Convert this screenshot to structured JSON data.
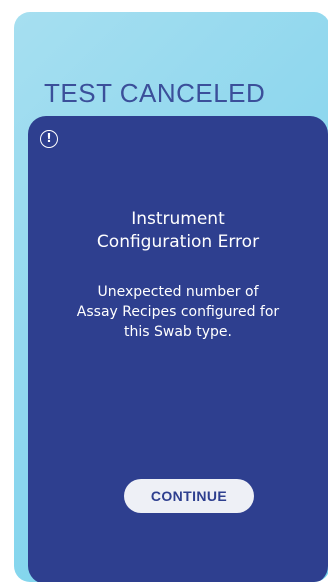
{
  "screen": {
    "title": "TEST CANCELED"
  },
  "dialog": {
    "icon": "alert-circle-icon",
    "title_line1": "Instrument",
    "title_line2": "Configuration Error",
    "message_line1": "Unexpected number of",
    "message_line2": "Assay Recipes configured for",
    "message_line3": "this Swab type.",
    "continue_label": "CONTINUE"
  },
  "colors": {
    "background_gradient_start": "#a6dff0",
    "background_gradient_end": "#72d3ec",
    "title_text": "#3b4f9a",
    "panel": "#2e3f8f",
    "button_bg": "#eef0f6",
    "button_text": "#2e3f8f"
  }
}
